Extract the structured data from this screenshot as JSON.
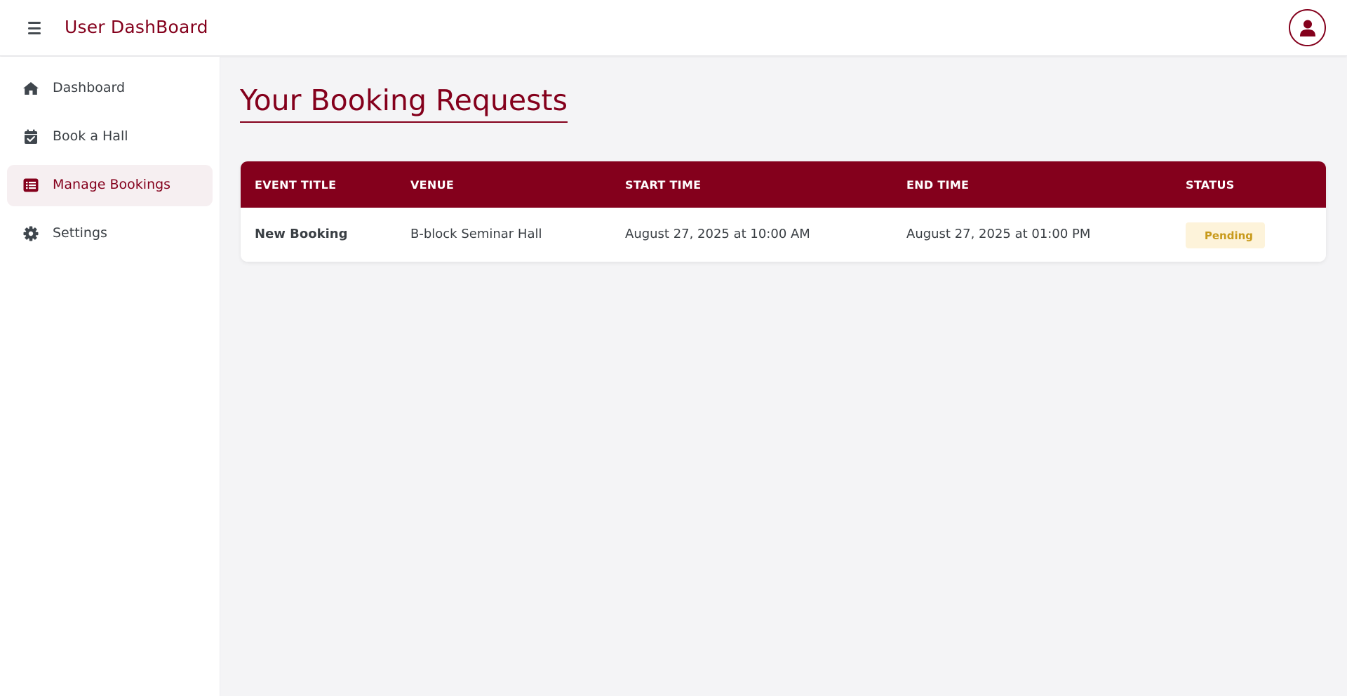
{
  "header": {
    "app_title": "User DashBoard",
    "menu_icon": "hamburger-menu-icon",
    "avatar_icon": "user-icon"
  },
  "sidebar": {
    "items": [
      {
        "label": "Dashboard",
        "icon": "home-icon",
        "active": false
      },
      {
        "label": "Book a Hall",
        "icon": "calendar-check-icon",
        "active": false
      },
      {
        "label": "Manage Bookings",
        "icon": "list-icon",
        "active": true
      },
      {
        "label": "Settings",
        "icon": "gear-icon",
        "active": false
      }
    ]
  },
  "main": {
    "page_title": "Your Booking Requests",
    "table": {
      "columns": [
        "EVENT TITLE",
        "VENUE",
        "START TIME",
        "END TIME",
        "STATUS"
      ],
      "rows": [
        {
          "event_title": "New Booking",
          "venue": "B-block Seminar Hall",
          "start_time": "August 27, 2025 at 10:00 AM",
          "end_time": "August 27, 2025 at 01:00 PM",
          "status": "Pending"
        }
      ]
    }
  },
  "colors": {
    "brand": "#84001c",
    "pending_bg": "#fdf3da",
    "pending_text": "#c89a1c",
    "background": "#f4f4f6"
  }
}
